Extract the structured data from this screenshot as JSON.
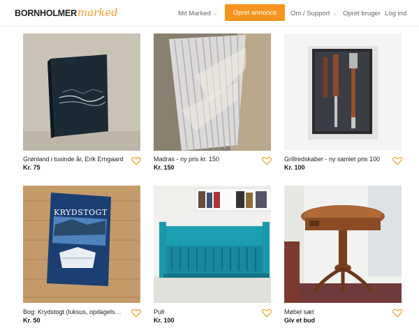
{
  "header": {
    "logo_bold": "BORNHOLMER",
    "logo_script": "marked",
    "nav_mit": "Mit Marked",
    "opret_annonce": "Opret annonce",
    "nav_support": "Om / Support",
    "opret_bruger": "Opret bruger",
    "log_ind": "Log ind"
  },
  "listings": [
    {
      "title": "Grønland i tusinde år, Erik Erngaard",
      "price": "Kr. 75"
    },
    {
      "title": "Madras - ny pris kr. 150",
      "price": "Kr. 150"
    },
    {
      "title": "Grillredskaber - ny samlet pris 100",
      "price": "Kr. 100"
    },
    {
      "title": "Bog: Krydstogt (luksus, opdagelsesrejs...",
      "price": "Kr. 50"
    },
    {
      "title": "Pult",
      "price": "Kr. 100"
    },
    {
      "title": "Møbel sæt",
      "price": "Giv et bud"
    }
  ],
  "book_cover_text": "KRYDSTOGT",
  "colors": {
    "accent": "#f7941d",
    "heart": "#e7a635"
  },
  "icons": {
    "favorite": "heart-outline-icon",
    "dropdown": "chevron-down-icon"
  }
}
